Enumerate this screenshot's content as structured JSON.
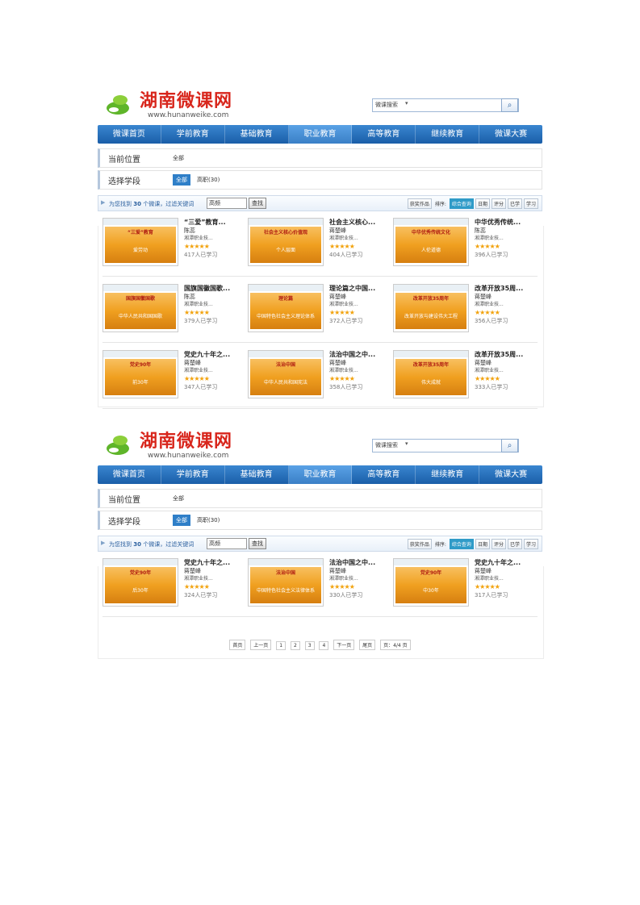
{
  "header": {
    "brand": "湖南微课网",
    "domain": "www.hunanweike.com",
    "search_category": "微课搜索",
    "search_value": "",
    "colors": {
      "brand_red": "#d8261c",
      "nav_blue": "#1a5ea8",
      "star": "#f2a20c"
    }
  },
  "nav": [
    "微课首页",
    "学前教育",
    "基础教育",
    "职业教育",
    "高等教育",
    "继续教育",
    "微课大赛"
  ],
  "location": {
    "label": "当前位置",
    "value": "全部"
  },
  "stage": {
    "label": "选择学段",
    "selected": "全部",
    "other": "高职(30)"
  },
  "filter": {
    "msg_prefix": "为您找到",
    "count": "30",
    "msg_suffix": "个微课，过滤关键词",
    "keyword": "高频",
    "go": "查找",
    "sort_buttons": [
      "获奖作品",
      "排序:",
      "综合查询",
      "日期",
      "评分",
      "已学",
      "学习"
    ]
  },
  "shot1_items": [
    {
      "title": "“三爱”教育...",
      "author": "陈蕊",
      "school": "湘潭职业技...",
      "stars": "★★★★★",
      "count": "417人已学习",
      "t1": "“三爱”教育",
      "t2": "爱劳动"
    },
    {
      "title": "社会主义核心...",
      "author": "蒋楚峰",
      "school": "湘潭职业技...",
      "stars": "★★★★★",
      "count": "404人已学习",
      "t1": "社会主义核心价值观",
      "t2": "个人层面"
    },
    {
      "title": "中华优秀传统...",
      "author": "陈蕊",
      "school": "湘潭职业技...",
      "stars": "★★★★★",
      "count": "396人已学习",
      "t1": "中华优秀传统文化",
      "t2": "人伦道德"
    },
    {
      "title": "国旗国徽国歌...",
      "author": "陈蕊",
      "school": "湘潭职业技...",
      "stars": "★★★★★",
      "count": "379人已学习",
      "t1": "国旗国徽国歌",
      "t2": "中华人民共和国国歌"
    },
    {
      "title": "理论篇之中国...",
      "author": "蒋楚峰",
      "school": "湘潭职业技...",
      "stars": "★★★★★",
      "count": "372人已学习",
      "t1": "理论篇",
      "t2": "中国特色社会主义理论体系"
    },
    {
      "title": "改革开放35周...",
      "author": "蒋楚峰",
      "school": "湘潭职业技...",
      "stars": "★★★★★",
      "count": "356人已学习",
      "t1": "改革开放35周年",
      "t2": "改革开放与建设伟大工程"
    },
    {
      "title": "党史九十年之...",
      "author": "蒋楚峰",
      "school": "湘潭职业技...",
      "stars": "★★★★★",
      "count": "347人已学习",
      "t1": "党史90年",
      "t2": "前30年"
    },
    {
      "title": "法治中国之中...",
      "author": "蒋楚峰",
      "school": "湘潭职业技...",
      "stars": "★★★★★",
      "count": "358人已学习",
      "t1": "法治中国",
      "t2": "中华人民共和国宪法"
    },
    {
      "title": "改革开放35周...",
      "author": "蒋楚峰",
      "school": "湘潭职业技...",
      "stars": "★★★★★",
      "count": "333人已学习",
      "t1": "改革开放35周年",
      "t2": "伟大成就"
    }
  ],
  "shot2_items": [
    {
      "title": "党史九十年之...",
      "author": "蒋楚峰",
      "school": "湘潭职业技...",
      "stars": "★★★★★",
      "count": "324人已学习",
      "t1": "党史90年",
      "t2": "后30年"
    },
    {
      "title": "法治中国之中...",
      "author": "蒋楚峰",
      "school": "湘潭职业技...",
      "stars": "★★★★★",
      "count": "330人已学习",
      "t1": "法治中国",
      "t2": "中国特色社会主义法律体系"
    },
    {
      "title": "党史九十年之...",
      "author": "蒋楚峰",
      "school": "湘潭职业技...",
      "stars": "★★★★★",
      "count": "317人已学习",
      "t1": "党史90年",
      "t2": "中30年"
    }
  ],
  "pager": [
    "首页",
    "上一页",
    "1",
    "2",
    "3",
    "4",
    "下一页",
    "尾页",
    "页：4/4 页"
  ]
}
